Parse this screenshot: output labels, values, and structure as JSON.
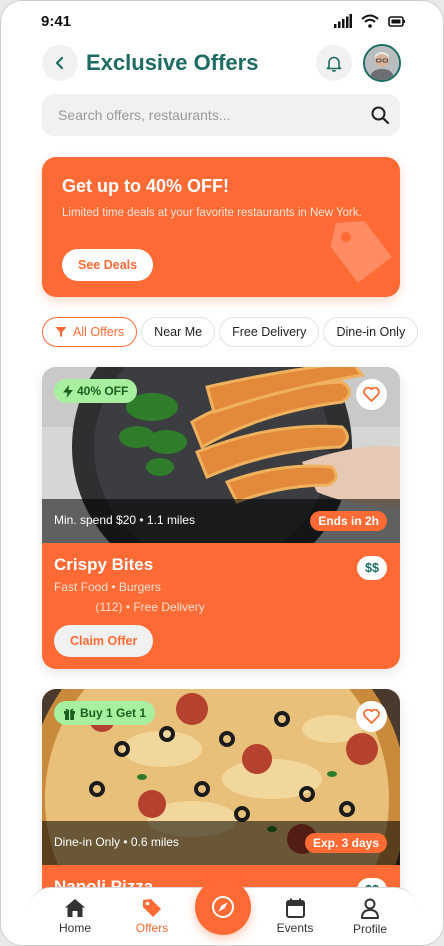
{
  "status_bar": {
    "time": "9:41"
  },
  "header": {
    "title": "Exclusive Offers"
  },
  "search": {
    "placeholder": "Search offers, restaurants..."
  },
  "promo": {
    "title": "Get up to 40% OFF!",
    "subtitle": "Limited time deals at your favorite restaurants in New York.",
    "button_label": "See Deals"
  },
  "filters": [
    {
      "label": "All Offers",
      "selected": true,
      "icon": "filter-icon"
    },
    {
      "label": "Near Me",
      "selected": false
    },
    {
      "label": "Free Delivery",
      "selected": false
    },
    {
      "label": "Dine-in Only",
      "selected": false
    }
  ],
  "offers": [
    {
      "badge": "40% OFF",
      "badge_icon": "bolt-icon",
      "info": "Min. spend $20 • 1.1 miles",
      "expiry": "Ends in 2h",
      "name": "Crispy Bites",
      "price": "$$",
      "cuisine": "Fast Food • Burgers",
      "reviews": "(112)",
      "delivery": "• Free Delivery",
      "claim_label": "Claim Offer"
    },
    {
      "badge": "Buy 1 Get 1",
      "badge_icon": "gift-icon",
      "info": "Dine-in Only • 0.6 miles",
      "expiry": "Exp. 3 days",
      "name": "Napoli Pizza",
      "price": "$$"
    }
  ],
  "bottom_nav": [
    {
      "label": "Home",
      "icon": "home-icon",
      "active": false
    },
    {
      "label": "Offers",
      "icon": "tag-icon",
      "active": true
    },
    {
      "label": "Events",
      "icon": "calendar-icon",
      "active": false
    },
    {
      "label": "Profile",
      "icon": "user-icon",
      "active": false
    }
  ],
  "colors": {
    "accent": "#ff6a35",
    "brand": "#1d6b63",
    "badge_green": "#a8f0a0"
  }
}
